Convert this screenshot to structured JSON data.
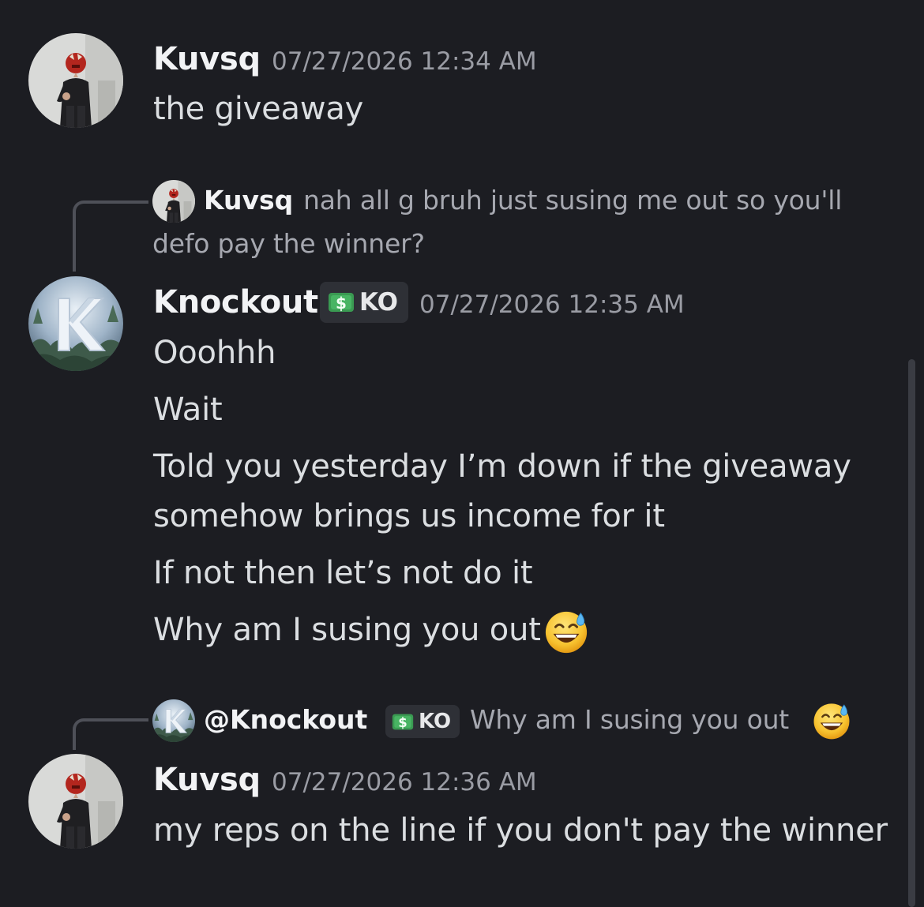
{
  "messages": [
    {
      "author": "Kuvsq",
      "timestamp": "07/27/2026 12:34 AM",
      "lines": [
        "the giveaway"
      ]
    },
    {
      "reply": {
        "author": "Kuvsq",
        "text_line1": "nah all g bruh just susing me out so you'll",
        "text_line2": "defo pay the winner?"
      },
      "author": "Knockout",
      "tag": "KO",
      "timestamp": "07/27/2026 12:35 AM",
      "lines": [
        "Ooohhh",
        "Wait",
        "Told you yesterday I’m down if the giveaway",
        "somehow brings us income for it",
        "If not then let’s not do it",
        "Why am I susing you out"
      ]
    },
    {
      "reply": {
        "author": "@Knockout",
        "tag": "KO",
        "text": "Why am I susing you out"
      },
      "author": "Kuvsq",
      "timestamp": "07/27/2026 12:36 AM",
      "lines": [
        "my reps on the line if you don't pay the winner"
      ]
    }
  ],
  "icons": {
    "tag_icon": "dollar-bill-icon",
    "emoji": "grinning-face-with-sweat-emoji"
  },
  "colors": {
    "background": "#1c1d22",
    "text": "#dbdee1",
    "username": "#f2f3f5",
    "timestamp": "#9a9ca4",
    "tag_background": "#2e3036",
    "reply_spine": "#4e5058"
  }
}
